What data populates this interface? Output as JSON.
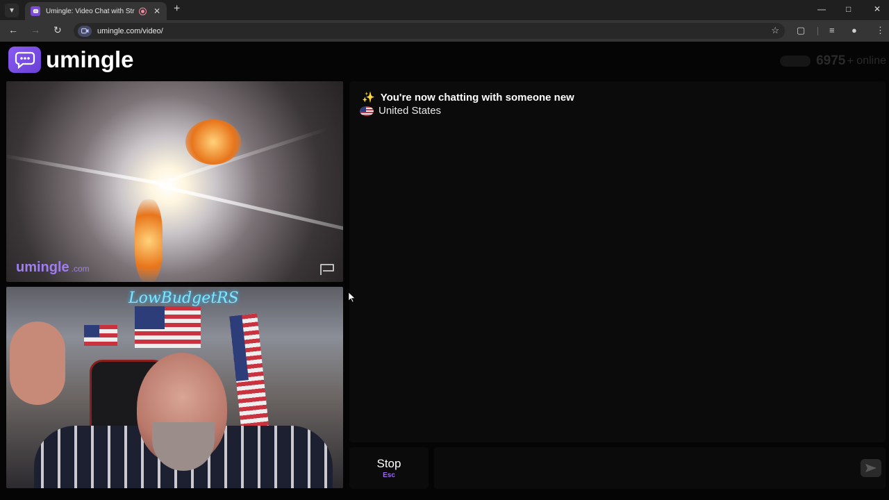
{
  "browser": {
    "tab_title": "Umingle: Video Chat with Strangers",
    "url": "umingle.com/video/",
    "icons": [
      "tab-list-icon",
      "favicon",
      "recording-icon",
      "close-icon",
      "new-tab-icon",
      "minimize-icon",
      "maximize-icon",
      "window-close-icon",
      "back-icon",
      "forward-icon",
      "reload-icon",
      "site-info-icon",
      "star-icon",
      "extensions-icon",
      "media-icon",
      "profile-icon",
      "menu-icon"
    ]
  },
  "header": {
    "logo_text": "umingle",
    "online_count": "6975",
    "online_plus": "+",
    "online_label": "online"
  },
  "remote_video": {
    "watermark": "umingle",
    "watermark_suffix": ".com"
  },
  "local_video": {
    "neon_sign": "LowBudgetRS"
  },
  "chat": {
    "status_message": "You're now chatting with someone new",
    "sparkle_glyph": "✨",
    "country": "United States"
  },
  "controls": {
    "stop_label": "Stop",
    "stop_shortcut": "Esc",
    "message_placeholder": ""
  },
  "colors": {
    "brand": "#7b4dd6",
    "accent": "#9b6af0",
    "background": "#050505"
  }
}
